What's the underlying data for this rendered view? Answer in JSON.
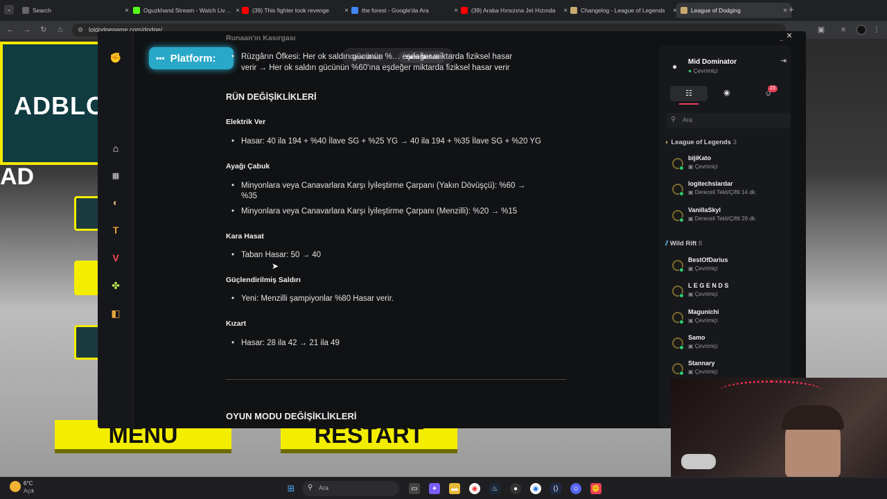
{
  "browser": {
    "tabs": [
      {
        "title": "Search",
        "fav_color": "#666666"
      },
      {
        "title": "Oguzkhand Stream - Watch Live on Kick",
        "fav_color": "#53fc18"
      },
      {
        "title": "(39) This fighter took revenge",
        "fav_color": "#ff0000"
      },
      {
        "title": "the forest - Google'da Ara",
        "fav_color": "#4285f4"
      },
      {
        "title": "(39) Araba Hırsızına Jet Hızında",
        "fav_color": "#ff0000"
      },
      {
        "title": "Changelog - League of Legends",
        "fav_color": "#c8aa6e"
      },
      {
        "title": "League of Dodging",
        "fav_color": "#c8aa6e"
      }
    ],
    "url": "loldodgegame.com/dodge/"
  },
  "game": {
    "adblock_text": "ADBLOCK",
    "ad_text": "AD",
    "menu_label": "MENU",
    "restart_label": "RESTART"
  },
  "app": {
    "platform_label": "Platform:",
    "topnav": {
      "overview": "Genel Bakış",
      "patch_notes": "Yama Notları"
    },
    "content": {
      "faded_heading": "Runaan'ın Kasırgası",
      "top_bullet_a": "Rüzgârın Öfkesi: Her ok saldırı gücünün %… eşdeğer miktarda fiziksel hasar",
      "top_bullet_b": "verir → Her ok saldırı gücünün %60'ına eşdeğer miktarda fiziksel hasar verir",
      "rune_heading": "RÜN DEĞİŞİKLİKLERİ",
      "items": [
        {
          "title": "Elektrik Ver",
          "bullets": [
            "Hasar: 40 ila 194 + %40 İlave SG + %25 YG → 40 ila 194 + %35 İlave SG + %20 YG"
          ]
        },
        {
          "title": "Ayağı Çabuk",
          "bullets": [
            "Minyonlara veya Canavarlara Karşı İyileştirme Çarpanı (Yakın Dövüşçü): %60 →",
            "%35",
            "Minyonlara veya Canavarlara Karşı İyileştirme Çarpanı (Menzilli): %20 → %15"
          ]
        },
        {
          "title": "Kara Hasat",
          "bullets": [
            "Taban Hasar: 50 → 40"
          ]
        },
        {
          "title": "Güçlendirilmiş Saldırı",
          "bullets": [
            "Yeni: Menzilli şampiyonlar %80 Hasar verir."
          ]
        },
        {
          "title": "Kızart",
          "bullets": [
            "Hasar: 28 ila 42 → 21 ila 49"
          ]
        }
      ],
      "game_mode_heading": "OYUN MODU DEĞİŞİKLİKLERİ"
    },
    "panel": {
      "user_name": "Mid Dominator",
      "user_status": "Çevrimiçi",
      "notif_count": "23",
      "search_placeholder": "Ara",
      "group_lol": "League of Legends",
      "group_lol_count": "3",
      "group_wr": "Wild Rift",
      "group_wr_count": "8",
      "friends_lol": [
        {
          "name": "bijiKato",
          "status": "Çevrimiçi"
        },
        {
          "name": "logitechslardar",
          "status": "Dereceli Tekli/Çiftli 14 dk."
        },
        {
          "name": "VanillaSkyl",
          "status": "Dereceli Tekli/Çiftli 29 dk."
        }
      ],
      "friends_wr": [
        {
          "name": "BestOfDarius",
          "status": "Çevrimiçi"
        },
        {
          "name": "L E G E N D S",
          "status": "Çevrimiçi"
        },
        {
          "name": "Magunichi",
          "status": "Çevrimiçi"
        },
        {
          "name": "Samo",
          "status": "Çevrimiçi"
        },
        {
          "name": "Stannary",
          "status": "Çevrimiçi"
        }
      ]
    }
  },
  "taskbar": {
    "weather_temp": "6°C",
    "weather_desc": "Açık",
    "search_placeholder": "Ara"
  }
}
